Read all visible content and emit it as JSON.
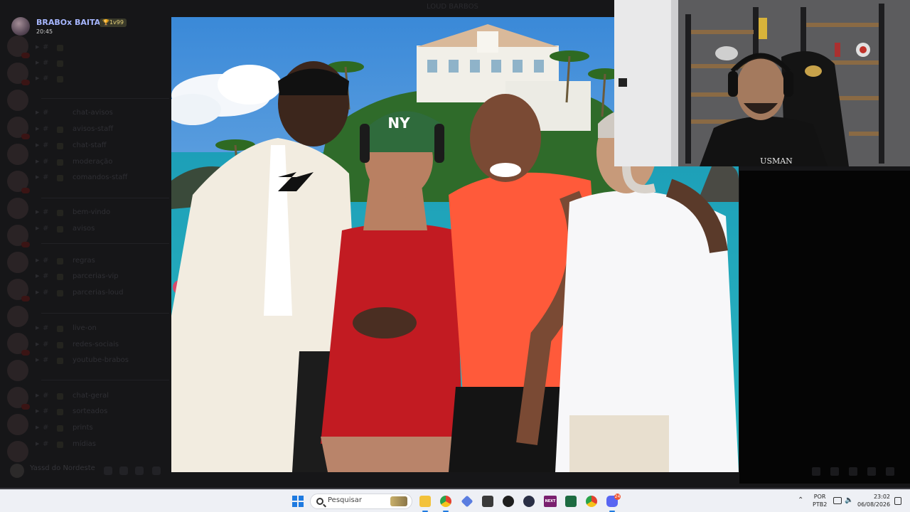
{
  "stream": {
    "name": "BRABOx BAITA ...",
    "badge": "🏆1v99",
    "time": "20:45"
  },
  "discord": {
    "guild_title": "LOUD BARBOS",
    "channels": [
      {
        "name": "",
        "count": ""
      },
      {
        "name": "",
        "count": ""
      },
      {
        "name": "",
        "count": ""
      },
      {
        "name": "chat-avisos",
        "count": ""
      },
      {
        "name": "avisos-staff",
        "count": ""
      },
      {
        "name": "chat-staff",
        "count": ""
      },
      {
        "name": "moderação",
        "count": ""
      },
      {
        "name": "comandos-staff",
        "count": ""
      },
      {
        "name": "bem-vindo",
        "count": ""
      },
      {
        "name": "avisos",
        "count": ""
      },
      {
        "name": "regras",
        "count": ""
      },
      {
        "name": "parcerias-vip",
        "count": ""
      },
      {
        "name": "parcerias-loud",
        "count": ""
      },
      {
        "name": "live-on",
        "count": ""
      },
      {
        "name": "redes-sociais",
        "count": ""
      },
      {
        "name": "youtube-brabos",
        "count": ""
      },
      {
        "name": "chat-geral",
        "count": ""
      },
      {
        "name": "sorteados",
        "count": ""
      },
      {
        "name": "prints",
        "count": ""
      },
      {
        "name": "mídias",
        "count": ""
      }
    ],
    "user_name": "Yassd do Nordeste"
  },
  "taskbar": {
    "search_placeholder": "Pesquisar",
    "lang_line1": "POR",
    "lang_line2": "PTB2",
    "time": "23:02",
    "date": "06/08/2026",
    "next_label": "NEXT",
    "discord_badge": "24"
  },
  "icons": {
    "start": "windows-logo",
    "explorer": "folder-icon",
    "chrome": "chrome-icon",
    "discord": "discord-icon"
  },
  "colors": {
    "accent": "#1e7ae0",
    "taskbar_bg": "#eef0f5",
    "streamer_name": "#a7b7ff"
  }
}
